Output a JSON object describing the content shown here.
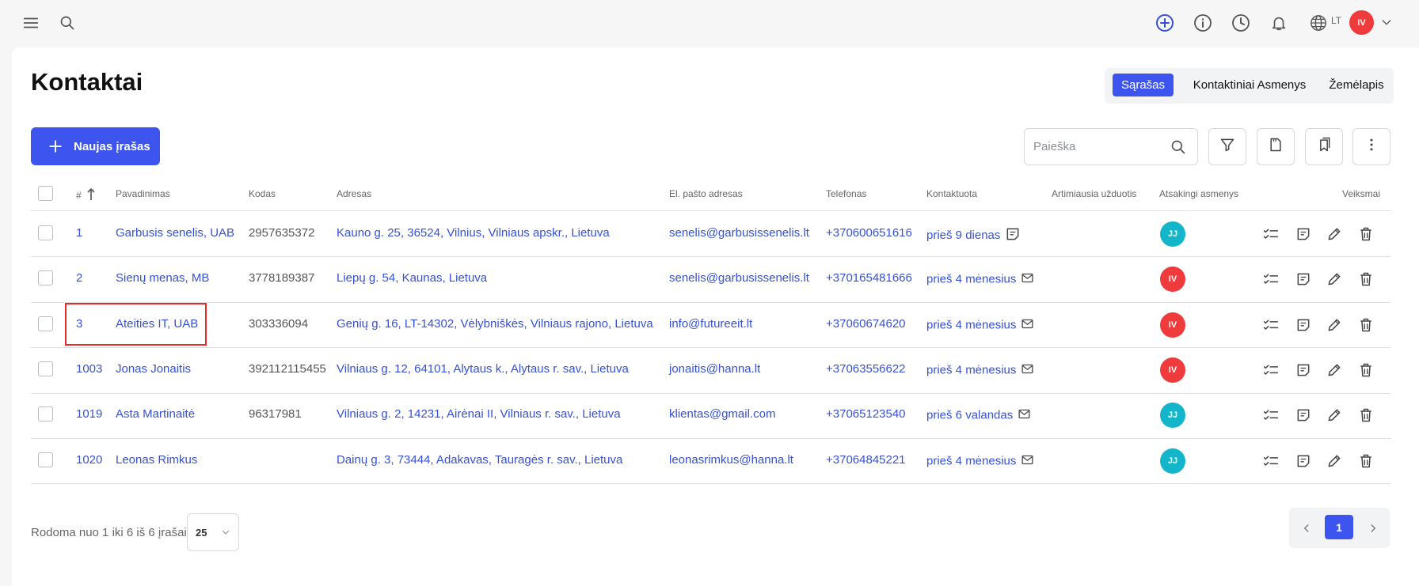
{
  "topbar": {
    "icons": [
      "menu-icon",
      "search-icon",
      "add-circle-icon",
      "info-icon",
      "clock-icon",
      "bell-icon",
      "globe-icon",
      "chevron-down-icon"
    ],
    "language": "LT",
    "user_initials": "IV"
  },
  "page": {
    "title": "Kontaktai"
  },
  "view_tabs": [
    {
      "label": "Sąrašas",
      "active": true
    },
    {
      "label": "Kontaktiniai Asmenys",
      "active": false
    },
    {
      "label": "Žemėlapis",
      "active": false
    }
  ],
  "toolbar": {
    "new_label": "Naujas įrašas",
    "search_placeholder": "Paieška",
    "icons": [
      "filter-icon",
      "export-file-icon",
      "bookmarks-icon",
      "more-vertical-icon"
    ]
  },
  "table": {
    "columns": [
      "#",
      "Pavadinimas",
      "Kodas",
      "Adresas",
      "El. pašto adresas",
      "Telefonas",
      "Kontaktuota",
      "Artimiausia užduotis",
      "Atsakingi asmenys",
      "Veiksmai"
    ],
    "rows": [
      {
        "id": "1",
        "name": "Garbusis senelis, UAB",
        "code": "2957635372",
        "address": "Kauno g. 25, 36524, Vilnius, Vilniaus apskr., Lietuva",
        "email": "senelis@garbusissenelis.lt",
        "phone": "+370600651616",
        "contacted": "prieš 9 dienas",
        "contact_icon": "note-icon",
        "task": "",
        "owner": "JJ",
        "owner_color": "#12b5c9"
      },
      {
        "id": "2",
        "name": "Sienų menas, MB",
        "code": "3778189387",
        "address": "Liepų g. 54, Kaunas, Lietuva",
        "email": "senelis@garbusissenelis.lt",
        "phone": "+370165481666",
        "contacted": "prieš 4 mėnesius",
        "contact_icon": "mail-icon",
        "task": "",
        "owner": "IV",
        "owner_color": "#ef3b3b"
      },
      {
        "id": "3",
        "name": "Ateities IT, UAB",
        "code": "303336094",
        "address": "Genių g. 16, LT-14302, Vėlybniškės, Vilniaus rajono, Lietuva",
        "email": "info@futureeit.lt",
        "phone": "+37060674620",
        "contacted": "prieš 4 mėnesius",
        "contact_icon": "mail-icon",
        "task": "",
        "owner": "IV",
        "owner_color": "#ef3b3b"
      },
      {
        "id": "1003",
        "name": "Jonas Jonaitis",
        "code": "392112115455",
        "address": "Vilniaus g. 12, 64101, Alytaus k., Alytaus r. sav., Lietuva",
        "email": "jonaitis@hanna.lt",
        "phone": "+37063556622",
        "contacted": "prieš 4 mėnesius",
        "contact_icon": "mail-icon",
        "task": "",
        "owner": "IV",
        "owner_color": "#ef3b3b"
      },
      {
        "id": "1019",
        "name": "Asta Martinaitė",
        "code": "96317981",
        "address": "Vilniaus g. 2, 14231, Airėnai II, Vilniaus r. sav., Lietuva",
        "email": "klientas@gmail.com",
        "phone": "+37065123540",
        "contacted": "prieš 6 valandas",
        "contact_icon": "mail-icon",
        "task": "",
        "owner": "JJ",
        "owner_color": "#12b5c9"
      },
      {
        "id": "1020",
        "name": "Leonas Rimkus",
        "code": "",
        "address": "Dainų g. 3, 73444, Adakavas, Tauragės r. sav., Lietuva",
        "email": "leonasrimkus@hanna.lt",
        "phone": "+37064845221",
        "contacted": "prieš 4 mėnesius",
        "contact_icon": "mail-icon",
        "task": "",
        "owner": "JJ",
        "owner_color": "#12b5c9"
      }
    ],
    "row_actions": [
      "tasks-icon",
      "note-icon",
      "edit-icon",
      "delete-icon"
    ]
  },
  "footer": {
    "summary": "Rodoma nuo 1 iki 6 iš 6 įrašai",
    "per_page": "25",
    "current_page": "1"
  }
}
